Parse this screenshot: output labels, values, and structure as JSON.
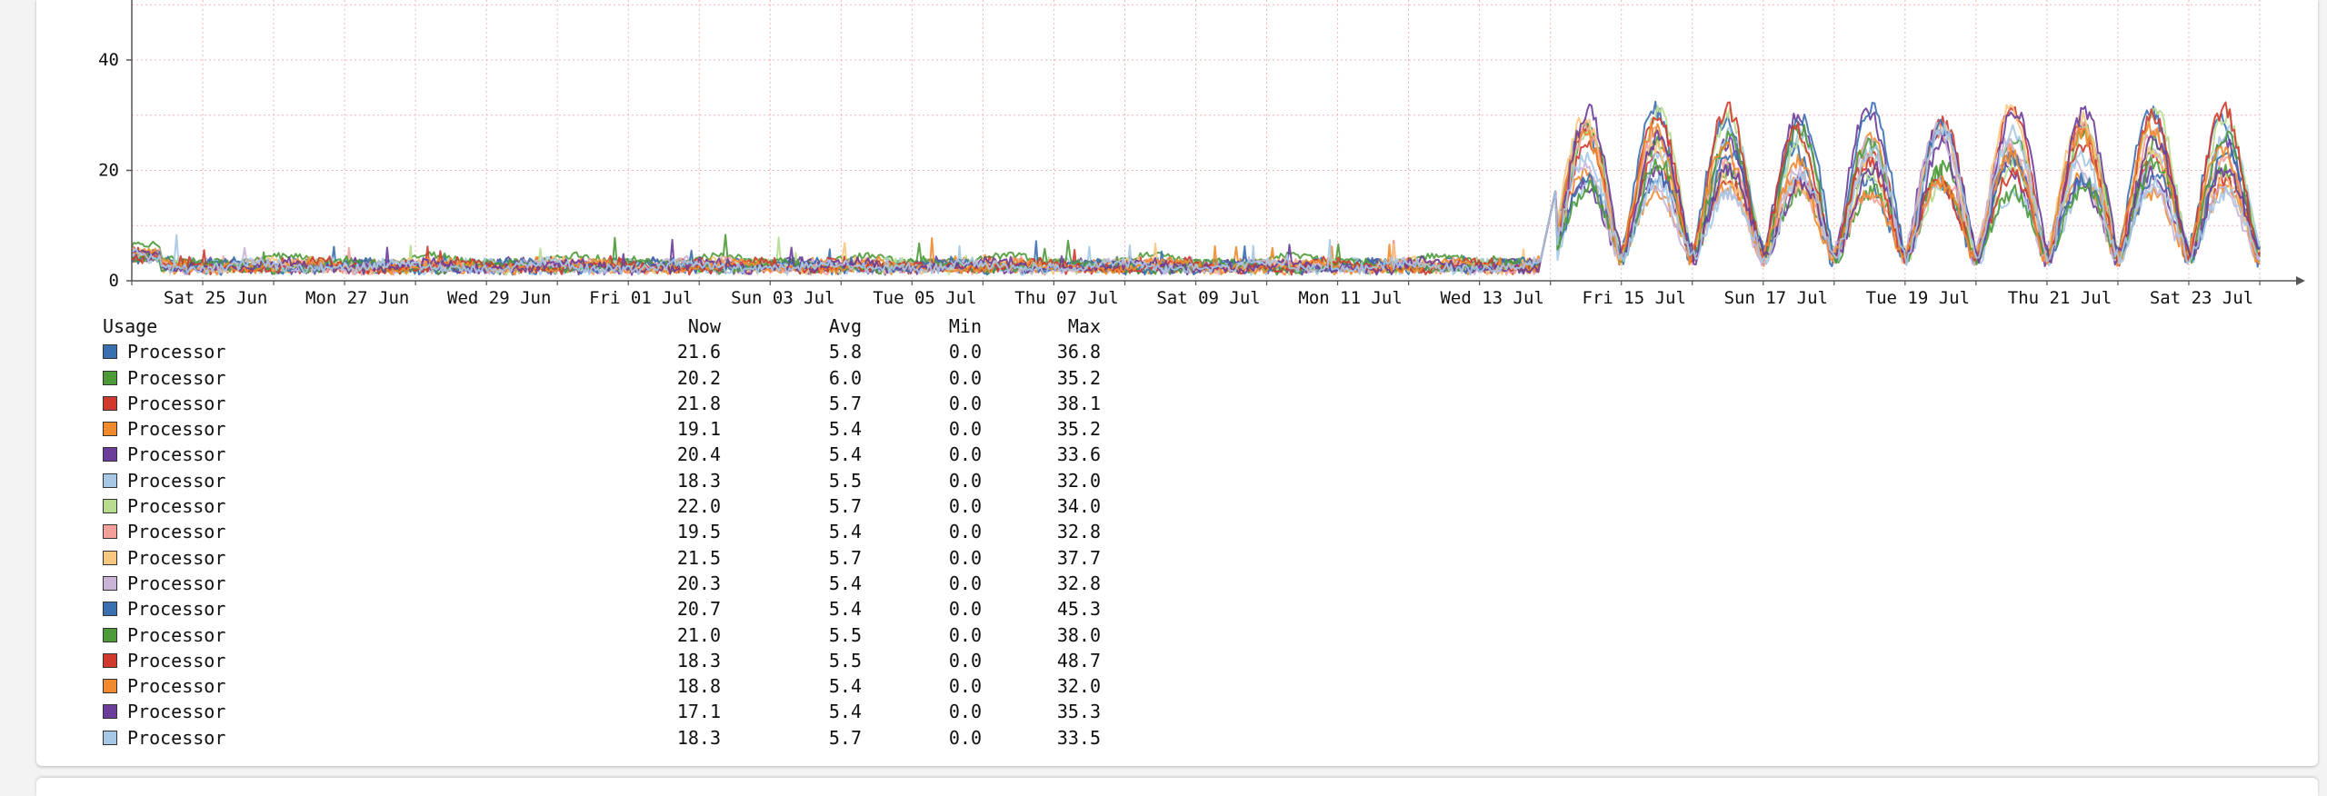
{
  "chart_data": {
    "type": "line",
    "y_ticks": [
      "0",
      "20",
      "40"
    ],
    "x_ticks": [
      "Sat 25 Jun",
      "Mon 27 Jun",
      "Wed 29 Jun",
      "Fri 01 Jul",
      "Sun 03 Jul",
      "Tue 05 Jul",
      "Thu 07 Jul",
      "Sat 09 Jul",
      "Mon 11 Jul",
      "Wed 13 Jul",
      "Fri 15 Jul",
      "Sun 17 Jul",
      "Tue 19 Jul",
      "Thu 21 Jul",
      "Sat 23 Jul"
    ],
    "ylim": [
      0,
      50
    ],
    "x_range": [
      "Fri 24 Jun",
      "Sun 24 Jul"
    ],
    "grid": true,
    "legend_position": "bottom-left",
    "colors": {
      "grid": "#f2b6b6",
      "axis": "#555555"
    },
    "series_summary": "16 overlapping processor series: about 0–5 from 24 Jun to 14 Jul, then daily peaks of about 25–35 with troughs near 3–5 from 15 Jul to 24 Jul"
  },
  "legend": {
    "headers": {
      "name": "Usage",
      "now": "Now",
      "avg": "Avg",
      "min": "Min",
      "max": "Max"
    },
    "rows": [
      {
        "name": "Processor",
        "color": "#3a6fb0",
        "now": "21.6",
        "avg": "5.8",
        "min": "0.0",
        "max": "36.8"
      },
      {
        "name": "Processor",
        "color": "#4c9a38",
        "now": "20.2",
        "avg": "6.0",
        "min": "0.0",
        "max": "35.2"
      },
      {
        "name": "Processor",
        "color": "#d03a2e",
        "now": "21.8",
        "avg": "5.7",
        "min": "0.0",
        "max": "38.1"
      },
      {
        "name": "Processor",
        "color": "#f08a2c",
        "now": "19.1",
        "avg": "5.4",
        "min": "0.0",
        "max": "35.2"
      },
      {
        "name": "Processor",
        "color": "#6a3d9a",
        "now": "20.4",
        "avg": "5.4",
        "min": "0.0",
        "max": "33.6"
      },
      {
        "name": "Processor",
        "color": "#a6c8e4",
        "now": "18.3",
        "avg": "5.5",
        "min": "0.0",
        "max": "32.0"
      },
      {
        "name": "Processor",
        "color": "#b7dc8e",
        "now": "22.0",
        "avg": "5.7",
        "min": "0.0",
        "max": "34.0"
      },
      {
        "name": "Processor",
        "color": "#f3a09a",
        "now": "19.5",
        "avg": "5.4",
        "min": "0.0",
        "max": "32.8"
      },
      {
        "name": "Processor",
        "color": "#f8c77f",
        "now": "21.5",
        "avg": "5.7",
        "min": "0.0",
        "max": "37.7"
      },
      {
        "name": "Processor",
        "color": "#c9b4d8",
        "now": "20.3",
        "avg": "5.4",
        "min": "0.0",
        "max": "32.8"
      },
      {
        "name": "Processor",
        "color": "#3a6fb0",
        "now": "20.7",
        "avg": "5.4",
        "min": "0.0",
        "max": "45.3"
      },
      {
        "name": "Processor",
        "color": "#4c9a38",
        "now": "21.0",
        "avg": "5.5",
        "min": "0.0",
        "max": "38.0"
      },
      {
        "name": "Processor",
        "color": "#d03a2e",
        "now": "18.3",
        "avg": "5.5",
        "min": "0.0",
        "max": "48.7"
      },
      {
        "name": "Processor",
        "color": "#f08a2c",
        "now": "18.8",
        "avg": "5.4",
        "min": "0.0",
        "max": "32.0"
      },
      {
        "name": "Processor",
        "color": "#6a3d9a",
        "now": "17.1",
        "avg": "5.4",
        "min": "0.0",
        "max": "35.3"
      },
      {
        "name": "Processor",
        "color": "#a6c8e4",
        "now": "18.3",
        "avg": "5.7",
        "min": "0.0",
        "max": "33.5"
      }
    ]
  }
}
